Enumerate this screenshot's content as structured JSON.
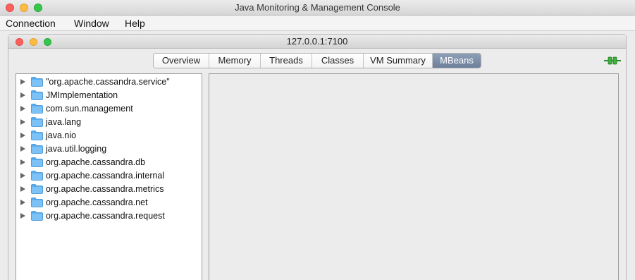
{
  "window": {
    "title": "Java Monitoring & Management Console"
  },
  "menubar": {
    "items": [
      "Connection",
      "Window",
      "Help"
    ]
  },
  "inner_window": {
    "title": "127.0.0.1:7100"
  },
  "tabs": [
    {
      "label": "Overview",
      "active": false
    },
    {
      "label": "Memory",
      "active": false
    },
    {
      "label": "Threads",
      "active": false
    },
    {
      "label": "Classes",
      "active": false
    },
    {
      "label": "VM Summary",
      "active": false
    },
    {
      "label": "MBeans",
      "active": true
    }
  ],
  "tree": {
    "items": [
      "\"org.apache.cassandra.service\"",
      "JMImplementation",
      "com.sun.management",
      "java.lang",
      "java.nio",
      "java.util.logging",
      "org.apache.cassandra.db",
      "org.apache.cassandra.internal",
      "org.apache.cassandra.metrics",
      "org.apache.cassandra.net",
      "org.apache.cassandra.request"
    ]
  },
  "icons": {
    "folder": "folder-icon",
    "expand": "triangle-right-icon",
    "connection": "connection-plug-icon"
  },
  "colors": {
    "active_tab": "#7a8ca6",
    "folder": "#5aaef0",
    "connected": "#3cb43c"
  }
}
